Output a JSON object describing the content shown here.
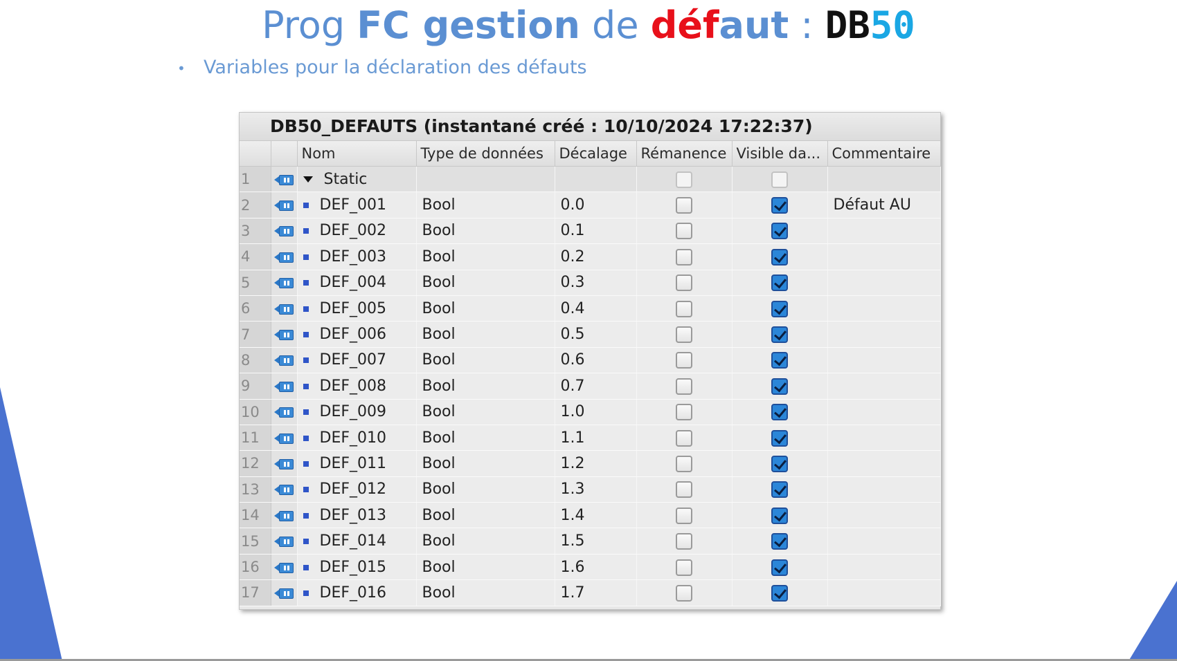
{
  "slide": {
    "title": {
      "part1": "Prog ",
      "part2": "FC gestion",
      "part3": " de ",
      "part4": "déf",
      "part5": "aut",
      "part6": " : ",
      "part7": "DB",
      "part8": "50"
    },
    "bullet_text": "Variables pour la déclaration des défauts",
    "bullet_char": "•"
  },
  "panel": {
    "title": "DB50_DEFAUTS (instantané créé : 10/10/2024 17:22:37)",
    "headers": {
      "rownum": "",
      "icon": "",
      "name": "Nom",
      "type": "Type de données",
      "offset": "Décalage",
      "retain": "Rémanence",
      "visible": "Visible da...",
      "comment": "Commentaire"
    },
    "static_row": {
      "num": "1",
      "name": "Static"
    },
    "rows": [
      {
        "num": "2",
        "name": "DEF_001",
        "type": "Bool",
        "offset": "0.0",
        "retain": false,
        "visible": true,
        "comment": "Défaut AU"
      },
      {
        "num": "3",
        "name": "DEF_002",
        "type": "Bool",
        "offset": "0.1",
        "retain": false,
        "visible": true,
        "comment": ""
      },
      {
        "num": "4",
        "name": "DEF_003",
        "type": "Bool",
        "offset": "0.2",
        "retain": false,
        "visible": true,
        "comment": ""
      },
      {
        "num": "5",
        "name": "DEF_004",
        "type": "Bool",
        "offset": "0.3",
        "retain": false,
        "visible": true,
        "comment": ""
      },
      {
        "num": "6",
        "name": "DEF_005",
        "type": "Bool",
        "offset": "0.4",
        "retain": false,
        "visible": true,
        "comment": ""
      },
      {
        "num": "7",
        "name": "DEF_006",
        "type": "Bool",
        "offset": "0.5",
        "retain": false,
        "visible": true,
        "comment": ""
      },
      {
        "num": "8",
        "name": "DEF_007",
        "type": "Bool",
        "offset": "0.6",
        "retain": false,
        "visible": true,
        "comment": ""
      },
      {
        "num": "9",
        "name": "DEF_008",
        "type": "Bool",
        "offset": "0.7",
        "retain": false,
        "visible": true,
        "comment": ""
      },
      {
        "num": "10",
        "name": "DEF_009",
        "type": "Bool",
        "offset": "1.0",
        "retain": false,
        "visible": true,
        "comment": ""
      },
      {
        "num": "11",
        "name": "DEF_010",
        "type": "Bool",
        "offset": "1.1",
        "retain": false,
        "visible": true,
        "comment": ""
      },
      {
        "num": "12",
        "name": "DEF_011",
        "type": "Bool",
        "offset": "1.2",
        "retain": false,
        "visible": true,
        "comment": ""
      },
      {
        "num": "13",
        "name": "DEF_012",
        "type": "Bool",
        "offset": "1.3",
        "retain": false,
        "visible": true,
        "comment": ""
      },
      {
        "num": "14",
        "name": "DEF_013",
        "type": "Bool",
        "offset": "1.4",
        "retain": false,
        "visible": true,
        "comment": ""
      },
      {
        "num": "15",
        "name": "DEF_014",
        "type": "Bool",
        "offset": "1.5",
        "retain": false,
        "visible": true,
        "comment": ""
      },
      {
        "num": "16",
        "name": "DEF_015",
        "type": "Bool",
        "offset": "1.6",
        "retain": false,
        "visible": true,
        "comment": ""
      },
      {
        "num": "17",
        "name": "DEF_016",
        "type": "Bool",
        "offset": "1.7",
        "retain": false,
        "visible": true,
        "comment": ""
      }
    ]
  },
  "icons": {
    "db_icon": "db-block-icon",
    "member_icon": "bool-member-icon",
    "expand_icon": "triangle-down-icon"
  },
  "colors": {
    "title_blue": "#5b8fd2",
    "title_red": "#e8101a",
    "title_cyan": "#1aa7e4",
    "accent_deco": "#4a72d0"
  }
}
